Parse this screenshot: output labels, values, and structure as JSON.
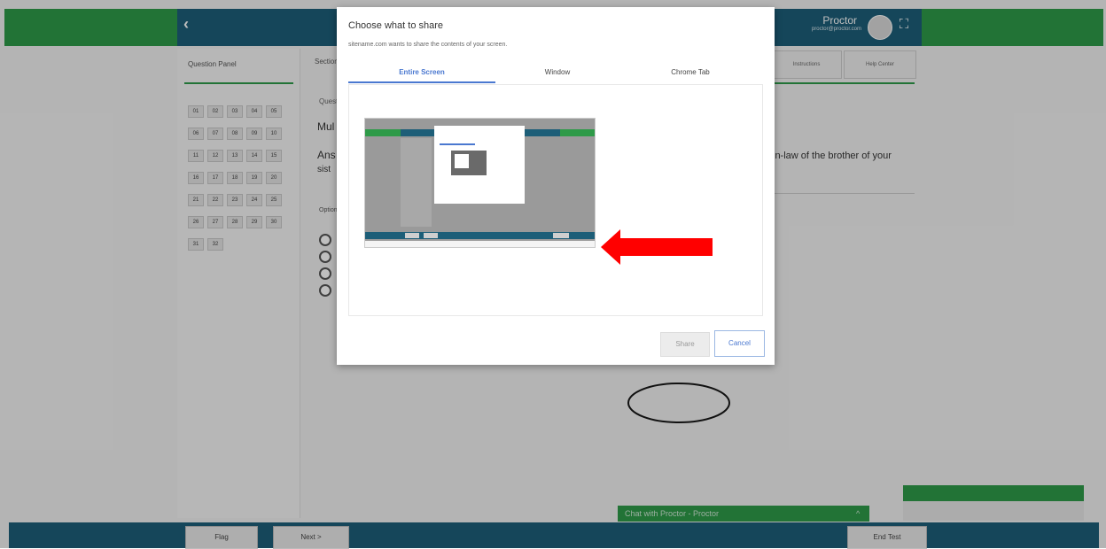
{
  "app": {
    "user_name": "Proctor",
    "user_email": "proctor@proctor.com",
    "panel_title": "Question Panel",
    "question_numbers": [
      "01",
      "02",
      "03",
      "04",
      "05",
      "06",
      "07",
      "08",
      "09",
      "10",
      "11",
      "12",
      "13",
      "14",
      "15",
      "16",
      "17",
      "18",
      "19",
      "20",
      "21",
      "22",
      "23",
      "24",
      "25",
      "26",
      "27",
      "28",
      "29",
      "30",
      "31",
      "32"
    ],
    "question_tab": "Section",
    "question_label": "Question",
    "question_type": "Mul",
    "question_text_start": "Ans",
    "question_text_line2": "sist",
    "question_text_end": "in-law of the brother of your",
    "options_label": "Options",
    "instructions_label": "Instructions",
    "help_label": "Help Center",
    "chat_label": "Chat with Proctor - Proctor",
    "flag_label": "Flag",
    "next_label": "Next >",
    "end_label": "End Test",
    "back_icon": "chevron-left-icon",
    "fullscreen_icon": "fullscreen-icon",
    "colors": {
      "green": "#2e9a48",
      "blue": "#1d5e78",
      "accent": "#4a78d0",
      "arrow": "#ff0000"
    }
  },
  "dialog": {
    "title": "Choose what to share",
    "subtitle": "sitename.com wants to share the contents of your screen.",
    "tabs": [
      {
        "label": "Entire Screen",
        "selected": true
      },
      {
        "label": "Window",
        "selected": false
      },
      {
        "label": "Chrome Tab",
        "selected": false
      }
    ],
    "share_label": "Share",
    "cancel_label": "Cancel"
  }
}
